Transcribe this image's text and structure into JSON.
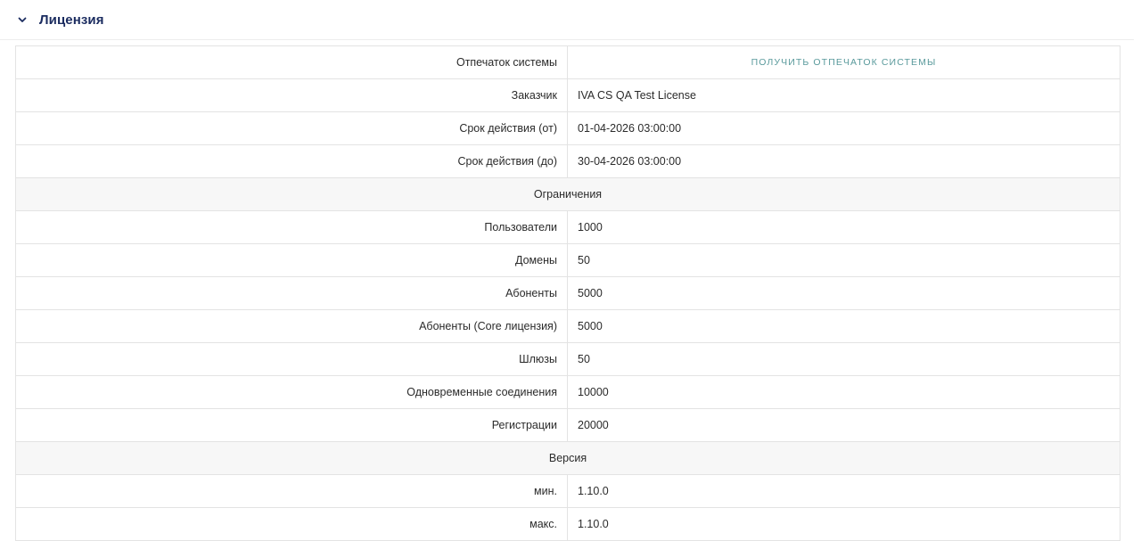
{
  "header": {
    "icon": "chevron-down-icon",
    "title": "Лицензия"
  },
  "colors": {
    "title": "#1a2b5f",
    "action_link": "#5a9a9c",
    "section_bg": "#f7f7f7",
    "border": "#e3e3e3"
  },
  "license": {
    "fingerprint": {
      "label": "Отпечаток системы",
      "action": "ПОЛУЧИТЬ ОТПЕЧАТОК СИСТЕМЫ"
    },
    "customer": {
      "label": "Заказчик",
      "value": "IVA CS QA Test License"
    },
    "valid_from": {
      "label": "Срок действия (от)",
      "value": "01-04-2026 03:00:00"
    },
    "valid_to": {
      "label": "Срок действия (до)",
      "value": "30-04-2026 03:00:00"
    },
    "limits_header": "Ограничения",
    "limits": {
      "users": {
        "label": "Пользователи",
        "value": "1000"
      },
      "domains": {
        "label": "Домены",
        "value": "50"
      },
      "subscribers": {
        "label": "Абоненты",
        "value": "5000"
      },
      "subscribers_core": {
        "label": "Абоненты (Core лицензия)",
        "value": "5000"
      },
      "gateways": {
        "label": "Шлюзы",
        "value": "50"
      },
      "concurrent": {
        "label": "Одновременные соединения",
        "value": "10000"
      },
      "registrations": {
        "label": "Регистрации",
        "value": "20000"
      }
    },
    "version_header": "Версия",
    "version": {
      "min": {
        "label": "мин.",
        "value": "1.10.0"
      },
      "max": {
        "label": "макс.",
        "value": "1.10.0"
      }
    }
  }
}
